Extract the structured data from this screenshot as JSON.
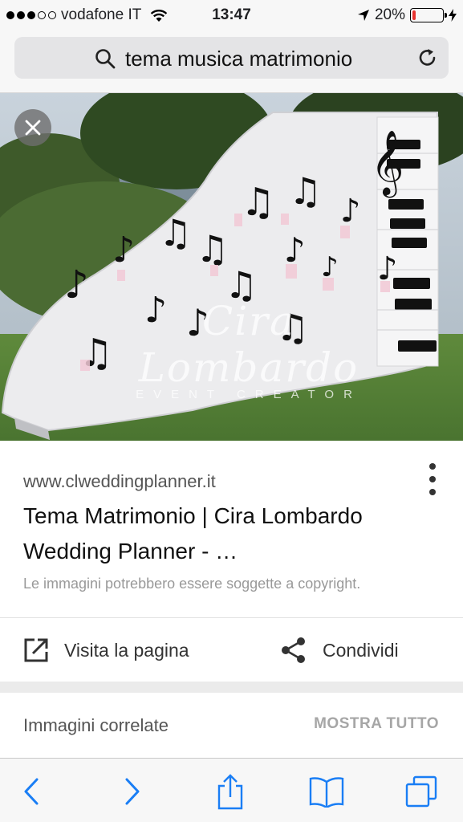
{
  "status_bar": {
    "carrier": "vodafone IT",
    "time": "13:47",
    "battery_percent": "20%",
    "battery_level": 0.2,
    "battery_color": "#e8332f"
  },
  "url_bar": {
    "query": "tema musica matrimonio",
    "search_icon": "search-icon",
    "reload_icon": "reload-icon"
  },
  "image_viewer": {
    "close_icon": "close-icon",
    "watermark_script": "Cira Lombardo",
    "watermark_sub": "EVENT CREATOR"
  },
  "result": {
    "source_url": "www.clweddingplanner.it",
    "title": "Tema Matrimonio | Cira Lombardo Wedding Planner - …",
    "copyright_notice": "Le immagini potrebbero essere soggette a copyright.",
    "more_icon": "more-vert-icon"
  },
  "actions": {
    "visit_label": "Visita la pagina",
    "share_label": "Condividi"
  },
  "related": {
    "title": "Immagini correlate",
    "show_all": "MOSTRA TUTTO"
  },
  "toolbar": {
    "items": [
      "back-icon",
      "forward-icon",
      "share-icon",
      "bookmarks-icon",
      "tabs-icon"
    ],
    "accent_color": "#1a7ef5"
  }
}
